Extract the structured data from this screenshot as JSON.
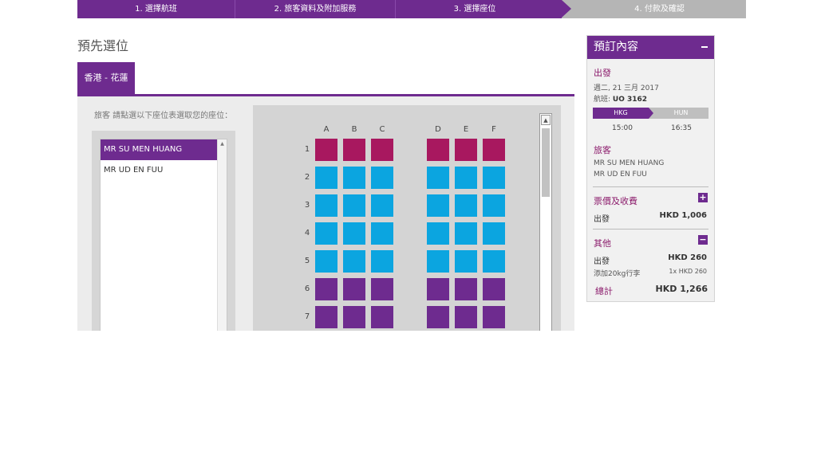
{
  "steps": [
    "1. 選擇航班",
    "2. 旅客資料及附加服務",
    "3. 選擇座位",
    "4. 付款及確認"
  ],
  "page_title": "預先選位",
  "route_tab": "香港 - 花蓮",
  "instruction": "旅客   請點選以下座位表選取您的座位：",
  "passengers": [
    "MR SU MEN HUANG",
    "MR UD EN FUU"
  ],
  "seat_columns": [
    "A",
    "B",
    "C",
    "D",
    "E",
    "F"
  ],
  "seat_rows": [
    {
      "num": "1",
      "type": "blocked"
    },
    {
      "num": "2",
      "type": "available"
    },
    {
      "num": "3",
      "type": "available"
    },
    {
      "num": "4",
      "type": "available"
    },
    {
      "num": "5",
      "type": "available"
    },
    {
      "num": "6",
      "type": "premium"
    },
    {
      "num": "7",
      "type": "premium"
    }
  ],
  "colors": {
    "brand": "#6e2b8f",
    "blocked": "#a8185f",
    "available": "#0ba5e0",
    "premium": "#6e2b8f"
  },
  "summary": {
    "title": "預訂內容",
    "departure_title": "出發",
    "date": "週二, 21 三月 2017",
    "flight_label": "航班:",
    "flight_no": "UO 3162",
    "from": "HKG",
    "to": "HUN",
    "dep_time": "15:00",
    "arr_time": "16:35",
    "pax_title": "旅客",
    "pax": [
      "MR SU MEN HUANG",
      "MR UD EN FUU"
    ],
    "fare_title": "票價及收費",
    "fare_label": "出發",
    "fare_value": "HKD 1,006",
    "other_title": "其他",
    "other_label": "出發",
    "other_value": "HKD  260",
    "baggage_label": "添加20kg行李",
    "baggage_value": "1x HKD 260",
    "total_label": "總計",
    "total_value": "HKD 1,266",
    "plus": "+",
    "minus": "−"
  },
  "icons": {
    "scroll_up": "▲"
  }
}
